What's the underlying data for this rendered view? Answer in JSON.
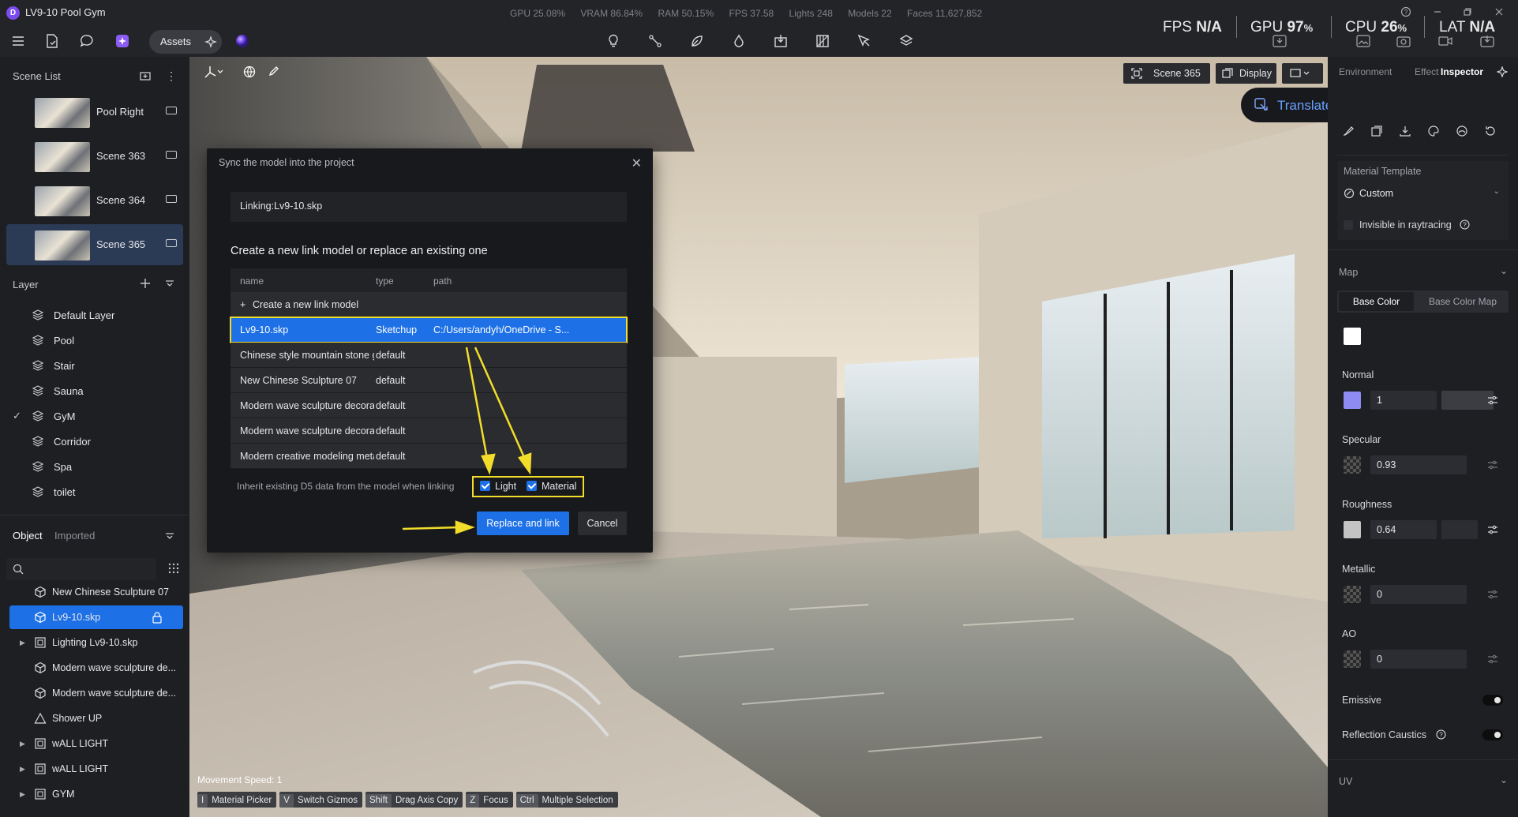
{
  "app": {
    "logo_letter": "D",
    "title": "LV9-10 Pool Gym"
  },
  "stats": {
    "gpu": "GPU 25.08%",
    "vram": "VRAM 86.84%",
    "ram": "RAM 50.15%",
    "fps": "FPS 37.58",
    "lights": "Lights 248",
    "models": "Models 22",
    "faces": "Faces 11,627,852"
  },
  "perf": {
    "fps_label": "FPS",
    "fps_value": "N/A",
    "gpu_label": "GPU",
    "gpu_value": "97",
    "gpu_unit": "%",
    "cpu_label": "CPU",
    "cpu_value": "26",
    "cpu_unit": "%",
    "lat_label": "LAT",
    "lat_value": "N/A"
  },
  "toolbar": {
    "assets_label": "Assets"
  },
  "scene_list": {
    "title": "Scene List",
    "items": [
      {
        "label": "Pool Right"
      },
      {
        "label": "Scene 363"
      },
      {
        "label": "Scene 364"
      },
      {
        "label": "Scene 365",
        "selected": true
      }
    ]
  },
  "layers": {
    "title": "Layer",
    "items": [
      {
        "label": "Default Layer"
      },
      {
        "label": "Pool"
      },
      {
        "label": "Stair"
      },
      {
        "label": "Sauna"
      },
      {
        "label": "GyM",
        "checked": true
      },
      {
        "label": "Corridor"
      },
      {
        "label": "Spa"
      },
      {
        "label": "toilet"
      }
    ]
  },
  "objects": {
    "tab_object": "Object",
    "tab_imported": "Imported",
    "items": [
      {
        "label": "New Chinese Sculpture 07"
      },
      {
        "label": "Lv9-10.skp",
        "selected": true
      },
      {
        "label": "Lighting Lv9-10.skp"
      },
      {
        "label": "Modern wave sculpture de..."
      },
      {
        "label": "Modern wave sculpture de..."
      },
      {
        "label": "Shower UP"
      },
      {
        "label": "wALL LIGHT"
      },
      {
        "label": "wALL LIGHT"
      },
      {
        "label": "GYM"
      }
    ]
  },
  "viewport": {
    "scene_button": "Scene 365",
    "display_button": "Display",
    "movement_speed": "Movement Speed: 1",
    "hints": [
      {
        "key": "I",
        "label": "Material Picker"
      },
      {
        "key": "V",
        "label": "Switch Gizmos"
      },
      {
        "key": "Shift",
        "label": "Drag Axis Copy"
      },
      {
        "key": "Z",
        "label": "Focus"
      },
      {
        "key": "Ctrl",
        "label": "Multiple Selection"
      }
    ]
  },
  "translate": {
    "label": "Translate to English"
  },
  "inspector": {
    "tabs": {
      "environment": "Environment",
      "effect": "Effect",
      "inspector": "Inspector"
    },
    "material_template_label": "Material Template",
    "material_template_value": "Custom",
    "invisible_label": "Invisible in raytracing",
    "map_label": "Map",
    "base_color_tab": "Base Color",
    "base_color_map_tab": "Base Color Map",
    "normal_label": "Normal",
    "normal_value": "1",
    "specular_label": "Specular",
    "specular_value": "0.93",
    "roughness_label": "Roughness",
    "roughness_value": "0.64",
    "metallic_label": "Metallic",
    "metallic_value": "0",
    "ao_label": "AO",
    "ao_value": "0",
    "emissive_label": "Emissive",
    "caustics_label": "Reflection Caustics",
    "uv_label": "UV",
    "colors": {
      "base": "#ffffff",
      "normal": "#8e8cf2",
      "roughness": "#c4c4c4"
    }
  },
  "dialog": {
    "title": "Sync the model into the project",
    "linking": "Linking:Lv9-10.skp",
    "heading": "Create a new link model or replace an existing one",
    "col_name": "name",
    "col_type": "type",
    "col_path": "path",
    "create_new": "Create a new link model",
    "rows": [
      {
        "name": "Lv9-10.skp",
        "type": "Sketchup",
        "path": "C:/Users/andyh/OneDrive - S..."
      },
      {
        "name": "Chinese style mountain stone g...",
        "type": "default",
        "path": ""
      },
      {
        "name": "New Chinese Sculpture 07",
        "type": "default",
        "path": ""
      },
      {
        "name": "Modern wave sculpture decora...",
        "type": "default",
        "path": ""
      },
      {
        "name": "Modern wave sculpture decora...",
        "type": "default",
        "path": ""
      },
      {
        "name": "Modern creative modeling meta...",
        "type": "default",
        "path": ""
      }
    ],
    "inherit_text": "Inherit existing D5 data from the model when linking",
    "light_label": "Light",
    "material_label": "Material",
    "replace_button": "Replace and link",
    "cancel_button": "Cancel"
  }
}
